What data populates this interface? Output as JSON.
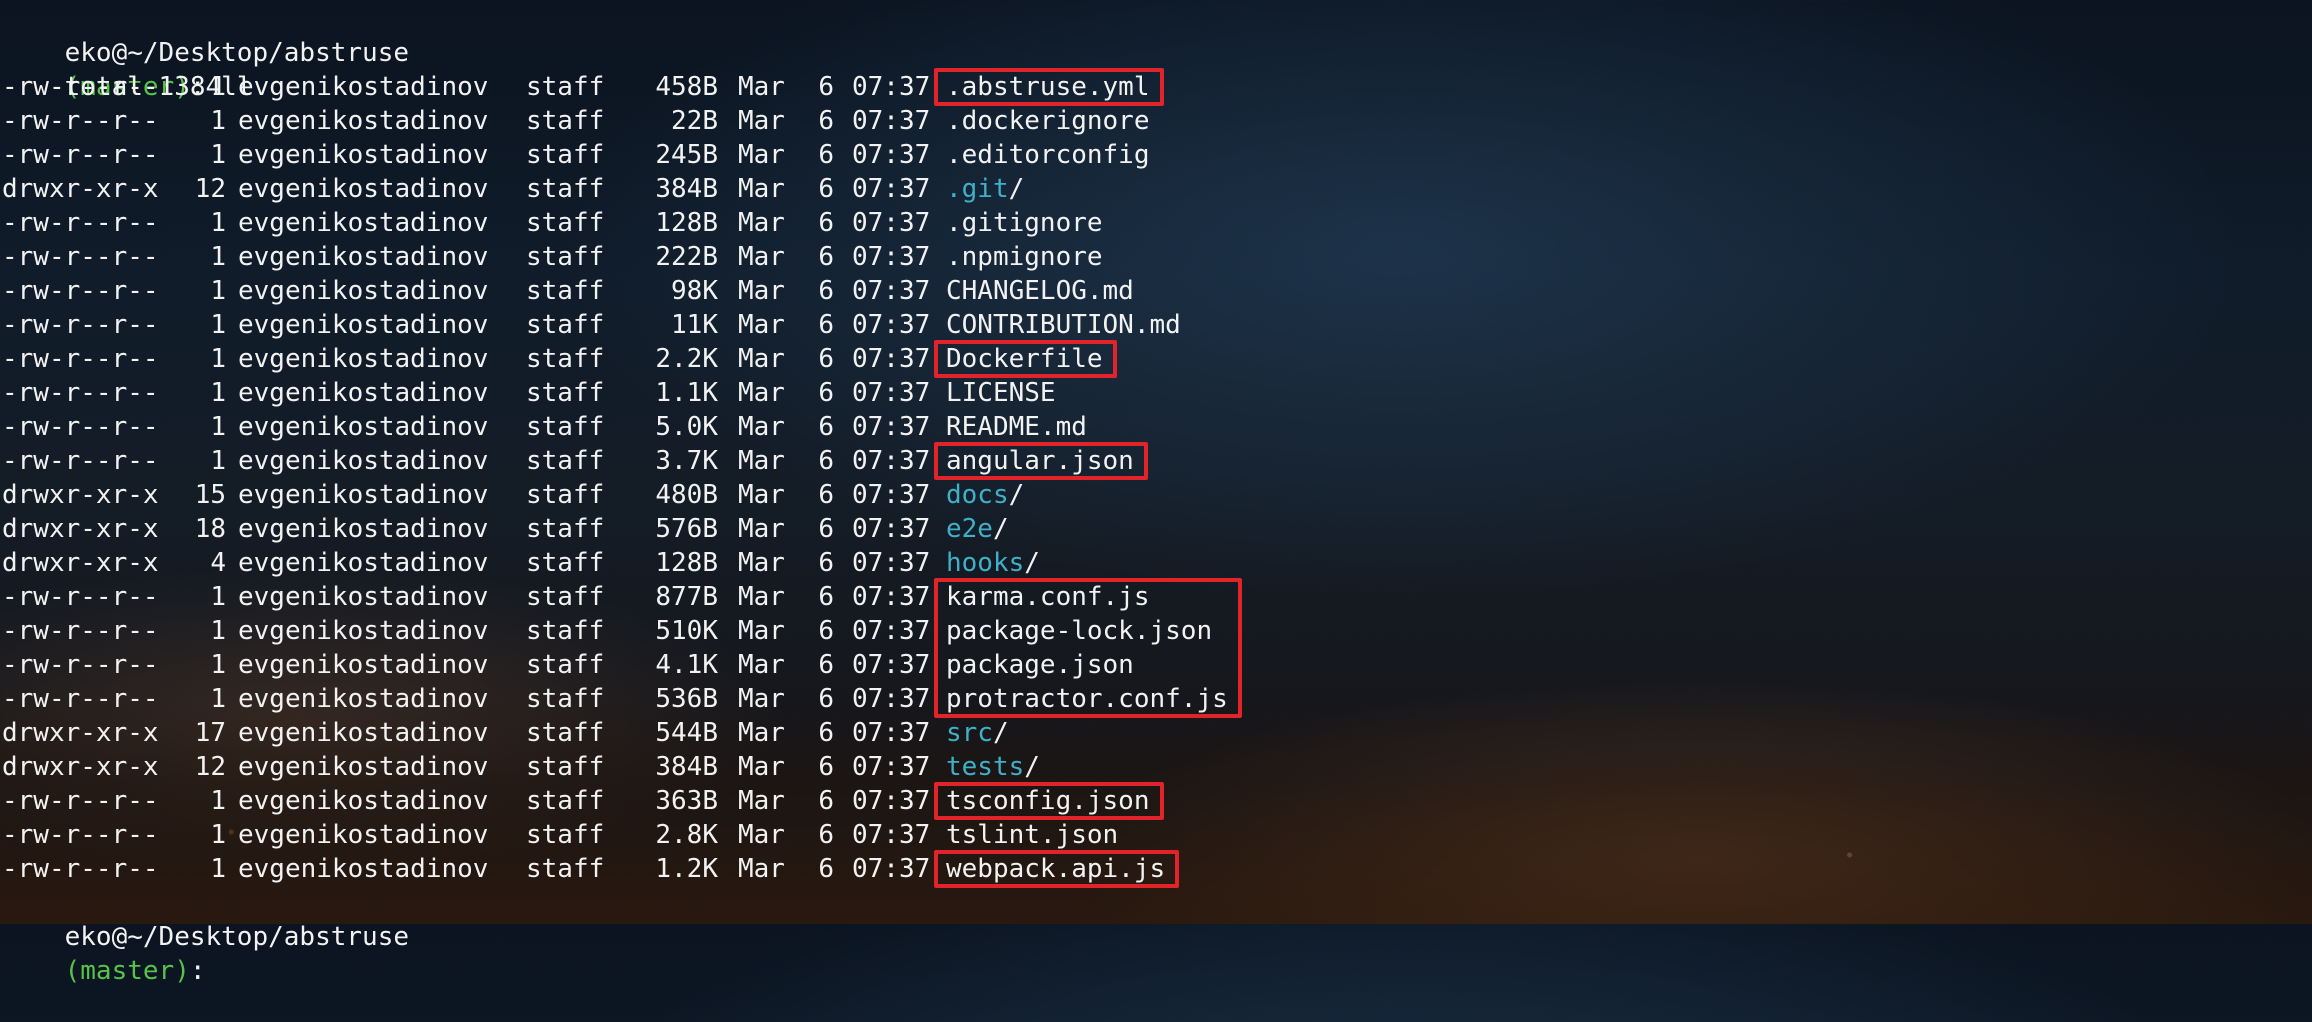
{
  "terminal": {
    "prompt_top": {
      "user_path": "eko@~/Desktop/abstruse",
      "branch": "(master)",
      "suffix": ": ",
      "command": "ll"
    },
    "total": "total 1384",
    "entries": [
      {
        "perm": "-rw-r--r--",
        "links": "1",
        "owner": "evgenikostadinov",
        "group": "staff",
        "size": "458B",
        "month": "Mar",
        "day": "6",
        "time": "07:37",
        "name": ".abstruse.yml",
        "is_dir": false
      },
      {
        "perm": "-rw-r--r--",
        "links": "1",
        "owner": "evgenikostadinov",
        "group": "staff",
        "size": "22B",
        "month": "Mar",
        "day": "6",
        "time": "07:37",
        "name": ".dockerignore",
        "is_dir": false
      },
      {
        "perm": "-rw-r--r--",
        "links": "1",
        "owner": "evgenikostadinov",
        "group": "staff",
        "size": "245B",
        "month": "Mar",
        "day": "6",
        "time": "07:37",
        "name": ".editorconfig",
        "is_dir": false
      },
      {
        "perm": "drwxr-xr-x",
        "links": "12",
        "owner": "evgenikostadinov",
        "group": "staff",
        "size": "384B",
        "month": "Mar",
        "day": "6",
        "time": "07:37",
        "name": ".git",
        "is_dir": true
      },
      {
        "perm": "-rw-r--r--",
        "links": "1",
        "owner": "evgenikostadinov",
        "group": "staff",
        "size": "128B",
        "month": "Mar",
        "day": "6",
        "time": "07:37",
        "name": ".gitignore",
        "is_dir": false
      },
      {
        "perm": "-rw-r--r--",
        "links": "1",
        "owner": "evgenikostadinov",
        "group": "staff",
        "size": "222B",
        "month": "Mar",
        "day": "6",
        "time": "07:37",
        "name": ".npmignore",
        "is_dir": false
      },
      {
        "perm": "-rw-r--r--",
        "links": "1",
        "owner": "evgenikostadinov",
        "group": "staff",
        "size": "98K",
        "month": "Mar",
        "day": "6",
        "time": "07:37",
        "name": "CHANGELOG.md",
        "is_dir": false
      },
      {
        "perm": "-rw-r--r--",
        "links": "1",
        "owner": "evgenikostadinov",
        "group": "staff",
        "size": "11K",
        "month": "Mar",
        "day": "6",
        "time": "07:37",
        "name": "CONTRIBUTION.md",
        "is_dir": false
      },
      {
        "perm": "-rw-r--r--",
        "links": "1",
        "owner": "evgenikostadinov",
        "group": "staff",
        "size": "2.2K",
        "month": "Mar",
        "day": "6",
        "time": "07:37",
        "name": "Dockerfile",
        "is_dir": false
      },
      {
        "perm": "-rw-r--r--",
        "links": "1",
        "owner": "evgenikostadinov",
        "group": "staff",
        "size": "1.1K",
        "month": "Mar",
        "day": "6",
        "time": "07:37",
        "name": "LICENSE",
        "is_dir": false
      },
      {
        "perm": "-rw-r--r--",
        "links": "1",
        "owner": "evgenikostadinov",
        "group": "staff",
        "size": "5.0K",
        "month": "Mar",
        "day": "6",
        "time": "07:37",
        "name": "README.md",
        "is_dir": false
      },
      {
        "perm": "-rw-r--r--",
        "links": "1",
        "owner": "evgenikostadinov",
        "group": "staff",
        "size": "3.7K",
        "month": "Mar",
        "day": "6",
        "time": "07:37",
        "name": "angular.json",
        "is_dir": false
      },
      {
        "perm": "drwxr-xr-x",
        "links": "15",
        "owner": "evgenikostadinov",
        "group": "staff",
        "size": "480B",
        "month": "Mar",
        "day": "6",
        "time": "07:37",
        "name": "docs",
        "is_dir": true
      },
      {
        "perm": "drwxr-xr-x",
        "links": "18",
        "owner": "evgenikostadinov",
        "group": "staff",
        "size": "576B",
        "month": "Mar",
        "day": "6",
        "time": "07:37",
        "name": "e2e",
        "is_dir": true
      },
      {
        "perm": "drwxr-xr-x",
        "links": "4",
        "owner": "evgenikostadinov",
        "group": "staff",
        "size": "128B",
        "month": "Mar",
        "day": "6",
        "time": "07:37",
        "name": "hooks",
        "is_dir": true
      },
      {
        "perm": "-rw-r--r--",
        "links": "1",
        "owner": "evgenikostadinov",
        "group": "staff",
        "size": "877B",
        "month": "Mar",
        "day": "6",
        "time": "07:37",
        "name": "karma.conf.js",
        "is_dir": false
      },
      {
        "perm": "-rw-r--r--",
        "links": "1",
        "owner": "evgenikostadinov",
        "group": "staff",
        "size": "510K",
        "month": "Mar",
        "day": "6",
        "time": "07:37",
        "name": "package-lock.json",
        "is_dir": false
      },
      {
        "perm": "-rw-r--r--",
        "links": "1",
        "owner": "evgenikostadinov",
        "group": "staff",
        "size": "4.1K",
        "month": "Mar",
        "day": "6",
        "time": "07:37",
        "name": "package.json",
        "is_dir": false
      },
      {
        "perm": "-rw-r--r--",
        "links": "1",
        "owner": "evgenikostadinov",
        "group": "staff",
        "size": "536B",
        "month": "Mar",
        "day": "6",
        "time": "07:37",
        "name": "protractor.conf.js",
        "is_dir": false
      },
      {
        "perm": "drwxr-xr-x",
        "links": "17",
        "owner": "evgenikostadinov",
        "group": "staff",
        "size": "544B",
        "month": "Mar",
        "day": "6",
        "time": "07:37",
        "name": "src",
        "is_dir": true
      },
      {
        "perm": "drwxr-xr-x",
        "links": "12",
        "owner": "evgenikostadinov",
        "group": "staff",
        "size": "384B",
        "month": "Mar",
        "day": "6",
        "time": "07:37",
        "name": "tests",
        "is_dir": true
      },
      {
        "perm": "-rw-r--r--",
        "links": "1",
        "owner": "evgenikostadinov",
        "group": "staff",
        "size": "363B",
        "month": "Mar",
        "day": "6",
        "time": "07:37",
        "name": "tsconfig.json",
        "is_dir": false
      },
      {
        "perm": "-rw-r--r--",
        "links": "1",
        "owner": "evgenikostadinov",
        "group": "staff",
        "size": "2.8K",
        "month": "Mar",
        "day": "6",
        "time": "07:37",
        "name": "tslint.json",
        "is_dir": false
      },
      {
        "perm": "-rw-r--r--",
        "links": "1",
        "owner": "evgenikostadinov",
        "group": "staff",
        "size": "1.2K",
        "month": "Mar",
        "day": "6",
        "time": "07:37",
        "name": "webpack.api.js",
        "is_dir": false
      }
    ],
    "dir_suffix": "/",
    "prompt_bottom": {
      "user_path": "eko@~/Desktop/abstruse",
      "branch": "(master)",
      "suffix": ":"
    },
    "highlighted_entries": [
      ".abstruse.yml",
      "Dockerfile",
      "angular.json",
      "karma.conf.js",
      "package-lock.json",
      "package.json",
      "protractor.conf.js",
      "tsconfig.json",
      "webpack.api.js"
    ],
    "colors": {
      "text": "#f2f2f2",
      "branch": "#58c24a",
      "directory": "#3fb0c8",
      "highlight_border": "#e0242a"
    }
  }
}
